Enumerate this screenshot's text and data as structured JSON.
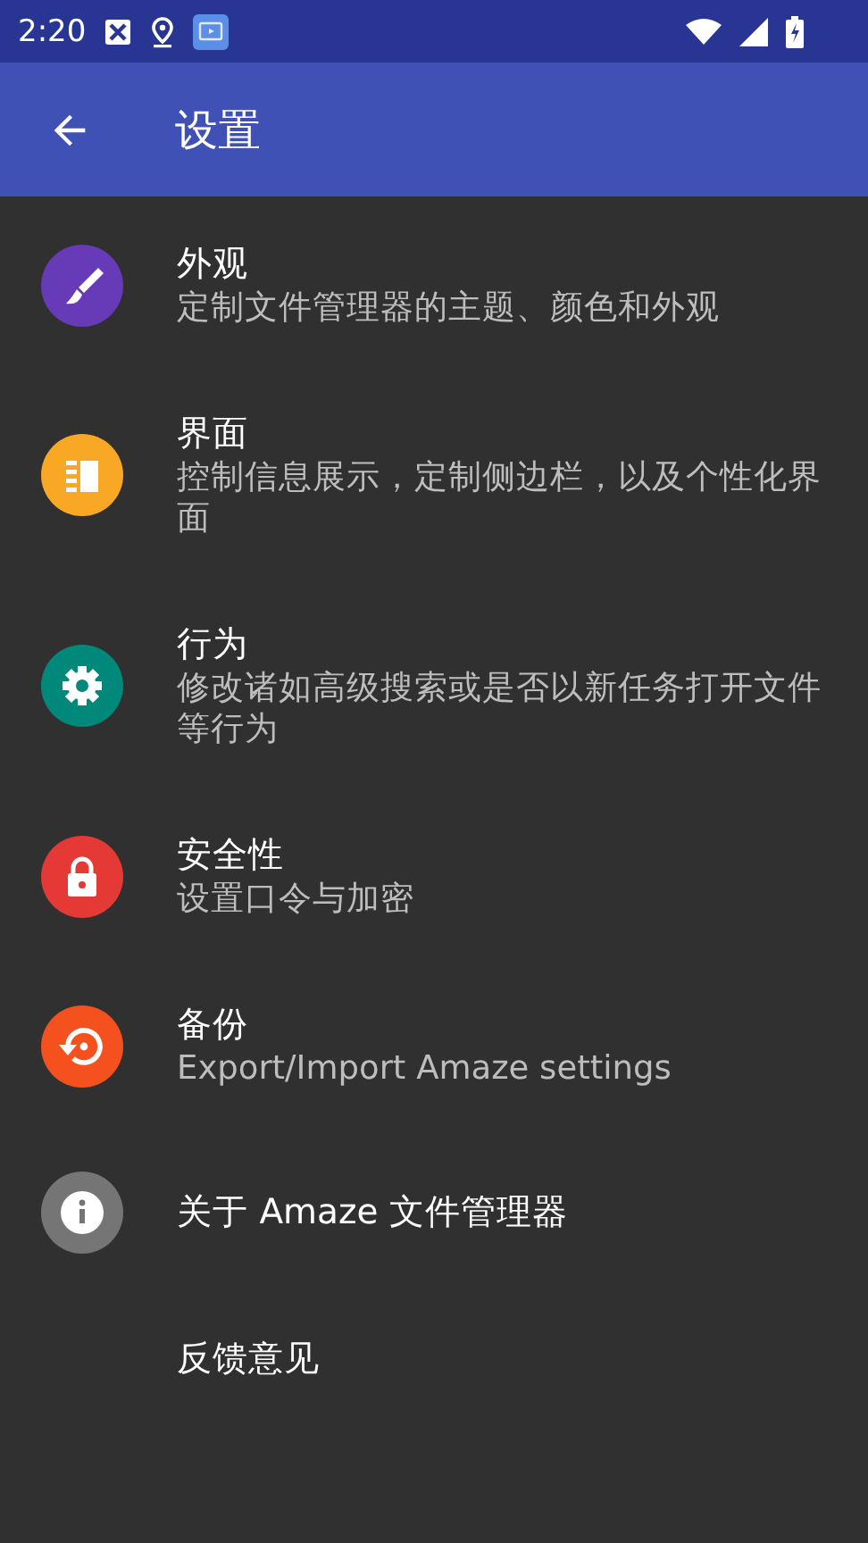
{
  "status_bar": {
    "time": "2:20"
  },
  "app_bar": {
    "title": "设置"
  },
  "items": [
    {
      "kind": "brush",
      "color": "#673ab7",
      "title": "外观",
      "subtitle": "定制文件管理器的主题、颜色和外观"
    },
    {
      "kind": "panel",
      "color": "#f9a825",
      "title": "界面",
      "subtitle": "控制信息展示，定制侧边栏，以及个性化界面"
    },
    {
      "kind": "gear",
      "color": "#00897b",
      "title": "行为",
      "subtitle": "修改诸如高级搜索或是否以新任务打开文件等行为"
    },
    {
      "kind": "lock",
      "color": "#e53935",
      "title": "安全性",
      "subtitle": "设置口令与加密"
    },
    {
      "kind": "restore",
      "color": "#f4511e",
      "title": "备份",
      "subtitle": "Export/Import Amaze settings"
    },
    {
      "kind": "info",
      "color": "#757575",
      "title": "关于 Amaze 文件管理器"
    },
    {
      "kind": "plain",
      "title": "反馈意见"
    }
  ]
}
